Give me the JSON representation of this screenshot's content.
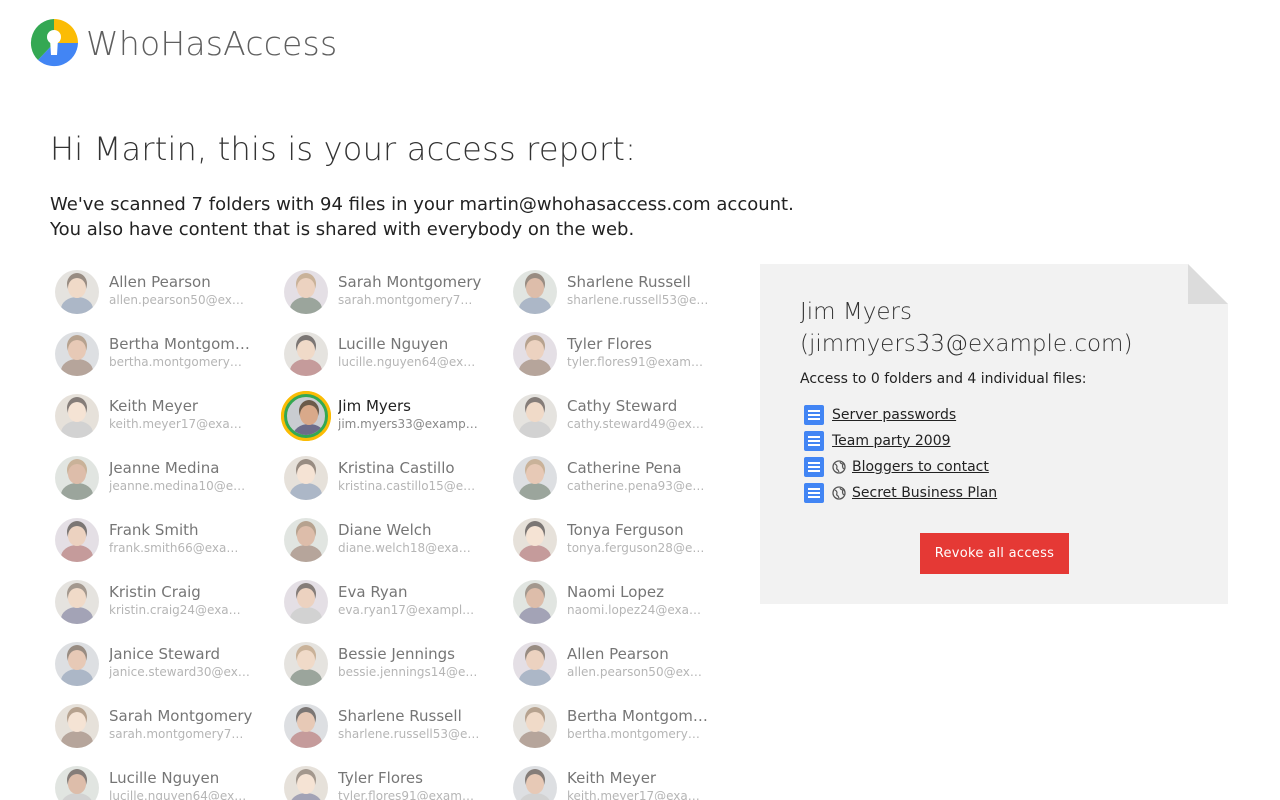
{
  "app": {
    "title": "WhoHasAccess"
  },
  "report": {
    "greeting": "Hi Martin, this is your access report:",
    "line1": "We've scanned 7 folders with 94 files in your martin@whohasaccess.com account.",
    "line2": "You also have content that is shared with everybody on the web."
  },
  "people": {
    "columns": [
      [
        {
          "name": "Allen Pearson",
          "email": "allen.pearson50@ex…"
        },
        {
          "name": "Bertha Montgom…",
          "email": "bertha.montgomery…"
        },
        {
          "name": "Keith Meyer",
          "email": "keith.meyer17@exa…"
        },
        {
          "name": "Jeanne Medina",
          "email": "jeanne.medina10@e…"
        },
        {
          "name": "Frank Smith",
          "email": "frank.smith66@exa…"
        },
        {
          "name": "Kristin Craig",
          "email": "kristin.craig24@exa…"
        },
        {
          "name": "Janice Steward",
          "email": "janice.steward30@ex…"
        },
        {
          "name": "Sarah Montgomery",
          "email": "sarah.montgomery7…"
        },
        {
          "name": "Lucille Nguyen",
          "email": "lucille.nguyen64@ex…"
        }
      ],
      [
        {
          "name": "Sarah Montgomery",
          "email": "sarah.montgomery7…"
        },
        {
          "name": "Lucille Nguyen",
          "email": "lucille.nguyen64@ex…"
        },
        {
          "name": "Jim Myers",
          "email": "jim.myers33@examp…",
          "selected": true
        },
        {
          "name": "Kristina Castillo",
          "email": "kristina.castillo15@e…"
        },
        {
          "name": "Diane Welch",
          "email": "diane.welch18@exa…"
        },
        {
          "name": "Eva Ryan",
          "email": "eva.ryan17@exampl…"
        },
        {
          "name": "Bessie Jennings",
          "email": "bessie.jennings14@e…"
        },
        {
          "name": "Sharlene Russell",
          "email": "sharlene.russell53@e…"
        },
        {
          "name": "Tyler Flores",
          "email": "tyler.flores91@exam…"
        }
      ],
      [
        {
          "name": "Sharlene Russell",
          "email": "sharlene.russell53@e…"
        },
        {
          "name": "Tyler Flores",
          "email": "tyler.flores91@exam…"
        },
        {
          "name": "Cathy Steward",
          "email": "cathy.steward49@ex…"
        },
        {
          "name": "Catherine Pena",
          "email": "catherine.pena93@e…"
        },
        {
          "name": "Tonya Ferguson",
          "email": "tonya.ferguson28@e…"
        },
        {
          "name": "Naomi Lopez",
          "email": "naomi.lopez24@exa…"
        },
        {
          "name": "Allen Pearson",
          "email": "allen.pearson50@ex…"
        },
        {
          "name": "Bertha Montgom…",
          "email": "bertha.montgomery…"
        },
        {
          "name": "Keith Meyer",
          "email": "keith.meyer17@exa…"
        }
      ]
    ]
  },
  "detail": {
    "name": "Jim Myers",
    "email": "(jimmyers33@example.com)",
    "summary": "Access to 0 folders and 4 individual files:",
    "files": [
      {
        "title": "Server passwords",
        "icon": "doc-icon",
        "public": false
      },
      {
        "title": "Team party 2009",
        "icon": "doc-icon",
        "public": false
      },
      {
        "title": "Bloggers to contact",
        "icon": "doc-icon",
        "public": true
      },
      {
        "title": "Secret Business Plan",
        "icon": "doc-icon",
        "public": true
      }
    ],
    "revoke_label": "Revoke all access"
  },
  "colors": {
    "revoke": "#e53935",
    "doc": "#4285f4",
    "card": "#f2f2f2",
    "logo_green": "#34a853",
    "logo_yellow": "#fbbc05",
    "logo_blue": "#4285f4"
  }
}
